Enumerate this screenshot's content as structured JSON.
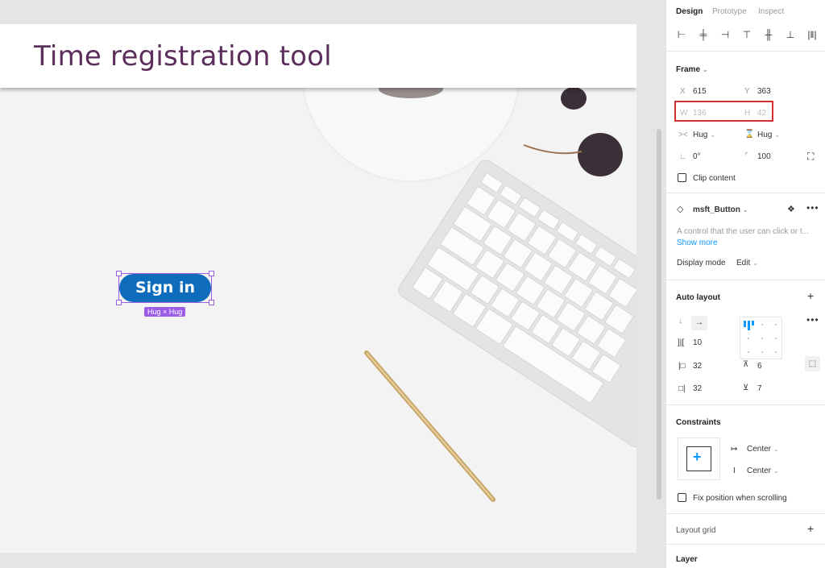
{
  "canvas": {
    "header_title": "Time registration tool",
    "button_label": "Sign in",
    "hug_badge": "Hug × Hug"
  },
  "panel": {
    "tabs": [
      "Design",
      "Prototype",
      "Inspect"
    ],
    "frame": {
      "title": "Frame",
      "x_label": "X",
      "x_value": "615",
      "y_label": "Y",
      "y_value": "363",
      "w_label": "W",
      "w_value": "136",
      "h_label": "H",
      "h_value": "42",
      "h_sizing": "Hug",
      "v_sizing": "Hug",
      "rotation": "0°",
      "radius": "100",
      "clip_content": "Clip content"
    },
    "component": {
      "name": "msft_Button",
      "description": "A control that the user can click or t...",
      "show_more": "Show more",
      "display_mode_label": "Display mode",
      "display_mode_value": "Edit"
    },
    "auto_layout": {
      "title": "Auto layout",
      "spacing": "10",
      "pad_left": "32",
      "pad_top": "6",
      "pad_right": "32",
      "pad_bottom": "7"
    },
    "constraints": {
      "title": "Constraints",
      "horizontal": "Center",
      "vertical": "Center",
      "fix_position": "Fix position when scrolling"
    },
    "layout_grid": "Layout grid",
    "layer": "Layer"
  },
  "colors": {
    "title_color": "#5c2e5c",
    "button_blue": "#0f6cbd",
    "selection_purple": "#9b5de5",
    "highlight_red": "#d32f2f",
    "link_blue": "#0d99ff"
  }
}
